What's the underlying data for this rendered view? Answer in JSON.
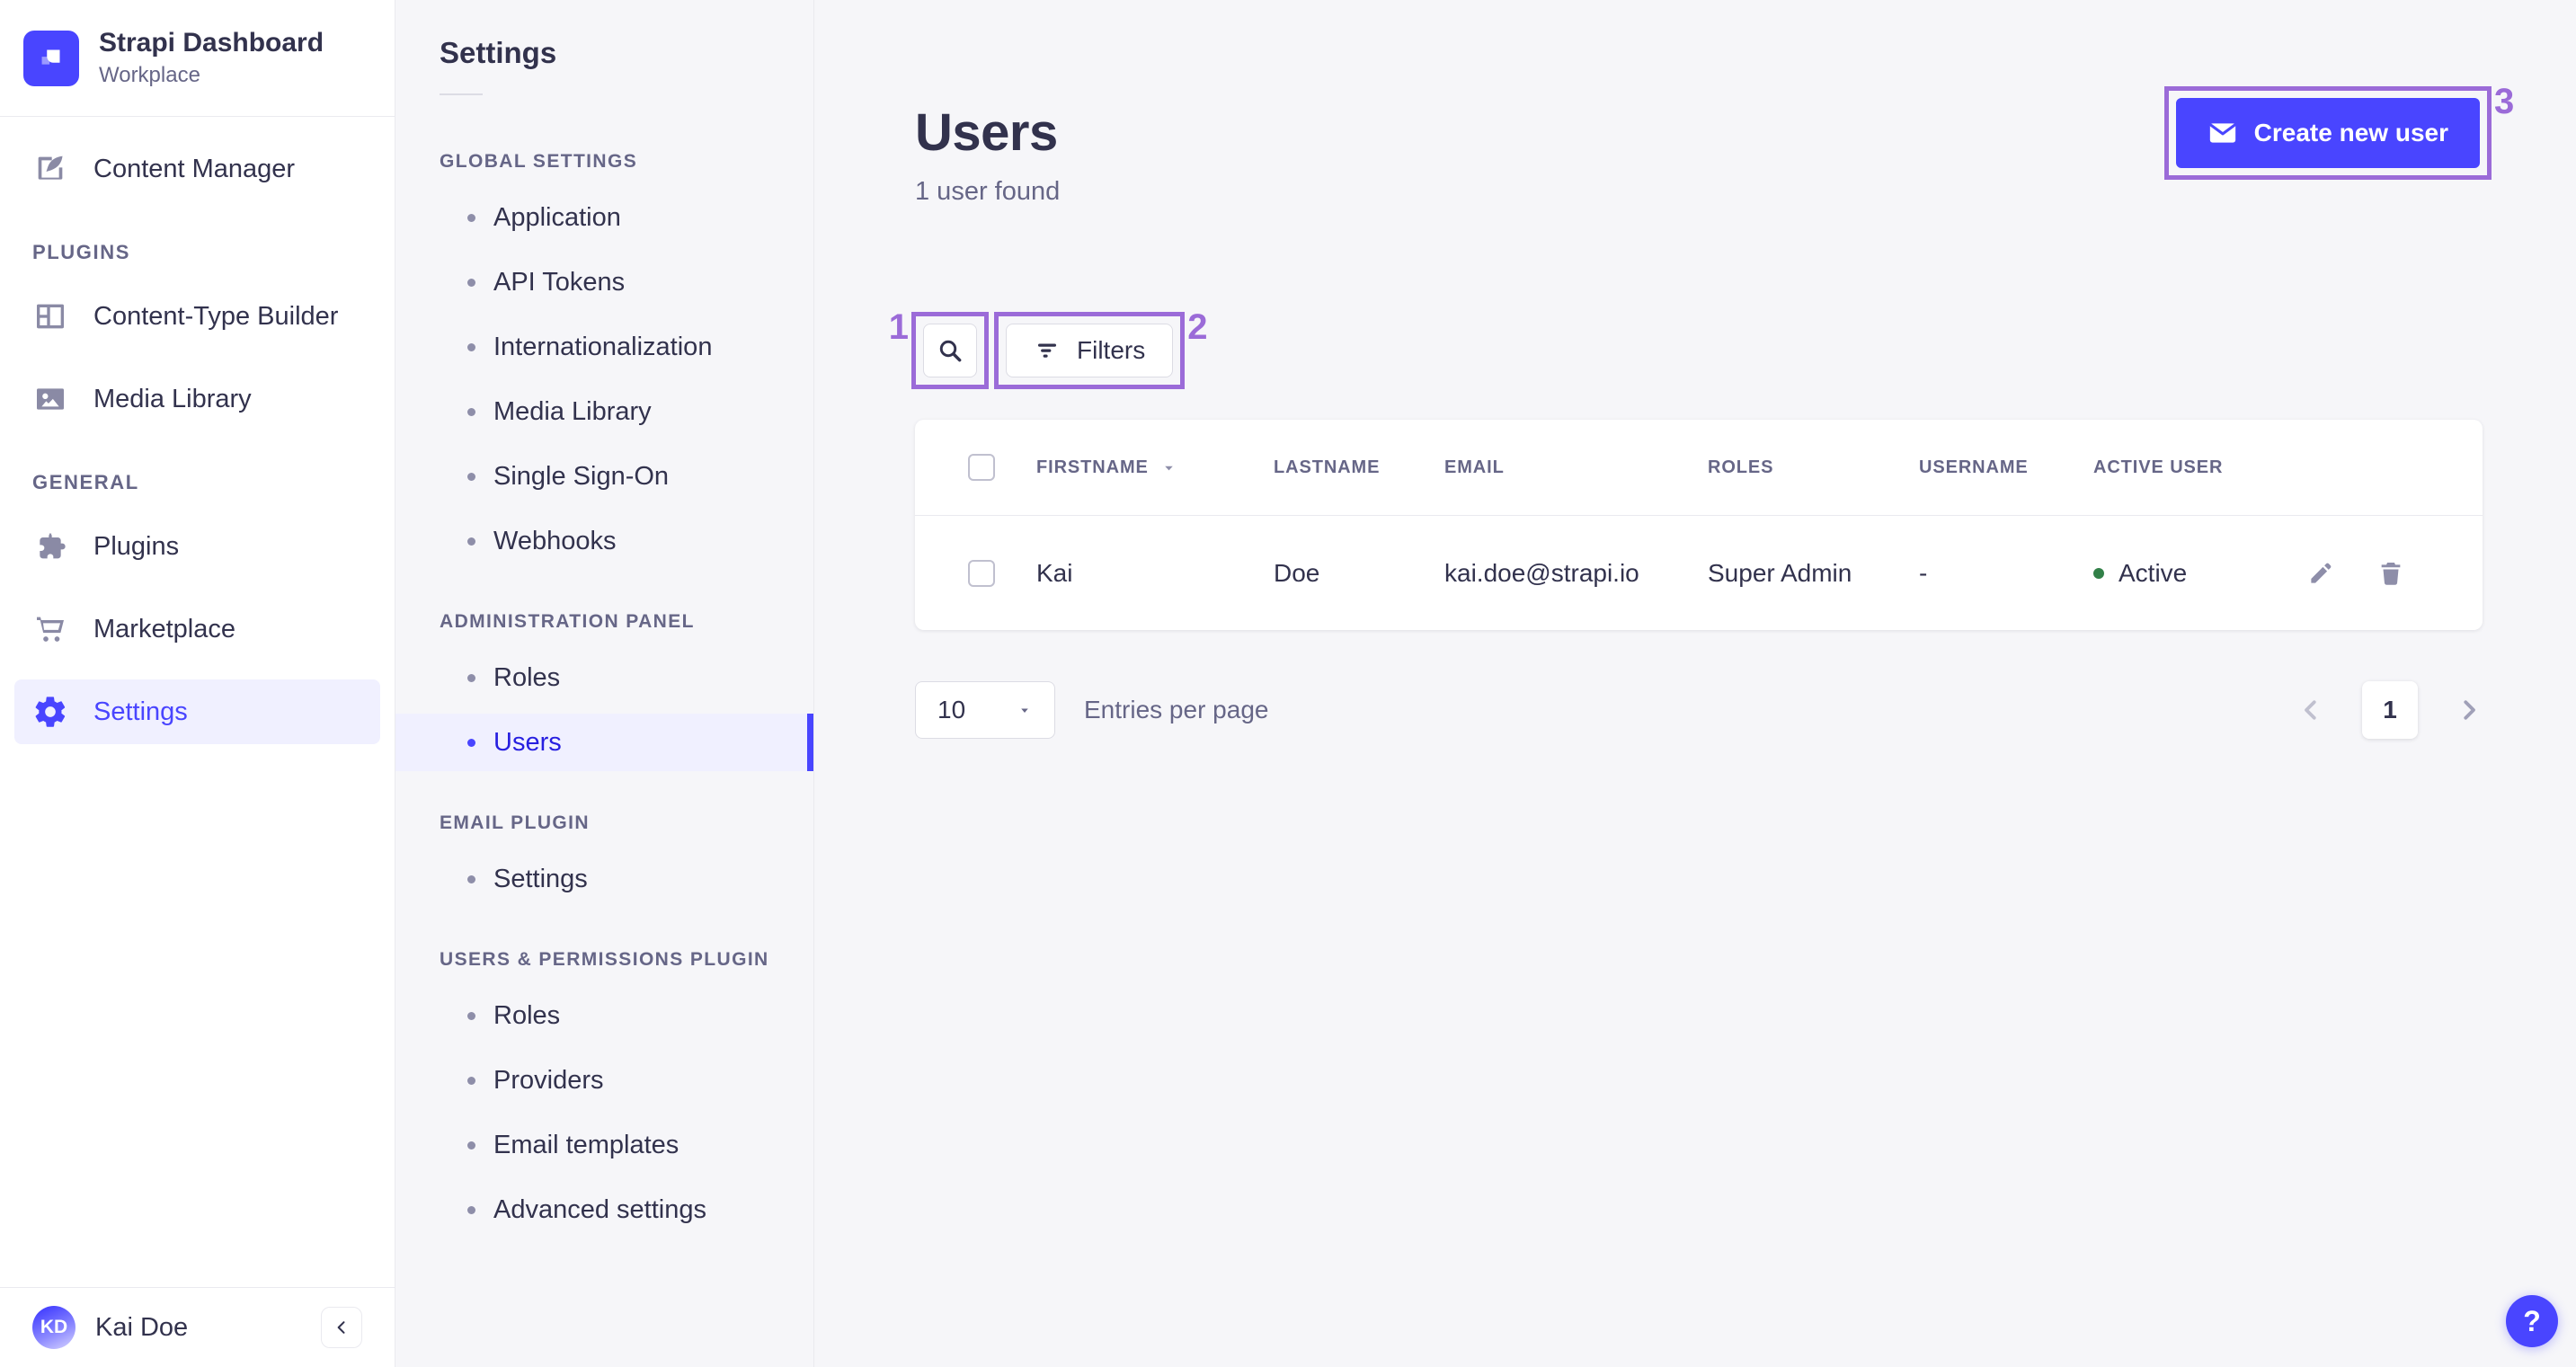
{
  "brand": {
    "title": "Strapi Dashboard",
    "subtitle": "Workplace"
  },
  "nav": {
    "content_manager": "Content Manager",
    "sections": [
      {
        "header": "PLUGINS",
        "items": [
          "Content-Type Builder",
          "Media Library"
        ]
      },
      {
        "header": "GENERAL",
        "items": [
          "Plugins",
          "Marketplace",
          "Settings"
        ]
      }
    ],
    "user": {
      "initials": "KD",
      "name": "Kai Doe"
    }
  },
  "subnav": {
    "title": "Settings",
    "active_item": "Users",
    "sections": [
      {
        "header": "GLOBAL SETTINGS",
        "items": [
          "Application",
          "API Tokens",
          "Internationalization",
          "Media Library",
          "Single Sign-On",
          "Webhooks"
        ]
      },
      {
        "header": "ADMINISTRATION PANEL",
        "items": [
          "Roles",
          "Users"
        ]
      },
      {
        "header": "EMAIL PLUGIN",
        "items": [
          "Settings"
        ]
      },
      {
        "header": "USERS & PERMISSIONS PLUGIN",
        "items": [
          "Roles",
          "Providers",
          "Email templates",
          "Advanced settings"
        ]
      }
    ]
  },
  "page": {
    "title": "Users",
    "subtitle": "1 user found",
    "create_button": "Create new user",
    "filters_button": "Filters"
  },
  "annotations": {
    "search_label": "1",
    "filters_label": "2",
    "create_label": "3"
  },
  "table": {
    "columns": [
      "FIRSTNAME",
      "LASTNAME",
      "EMAIL",
      "ROLES",
      "USERNAME",
      "ACTIVE USER"
    ],
    "rows": [
      {
        "firstname": "Kai",
        "lastname": "Doe",
        "email": "kai.doe@strapi.io",
        "roles": "Super Admin",
        "username": "-",
        "active_status": "Active"
      }
    ]
  },
  "pagination": {
    "page_size": "10",
    "entries_label": "Entries per page",
    "current_page": "1"
  },
  "help_label": "?",
  "colors": {
    "primary": "#4945ff",
    "annotation": "#9b6bd8",
    "success": "#328048"
  }
}
